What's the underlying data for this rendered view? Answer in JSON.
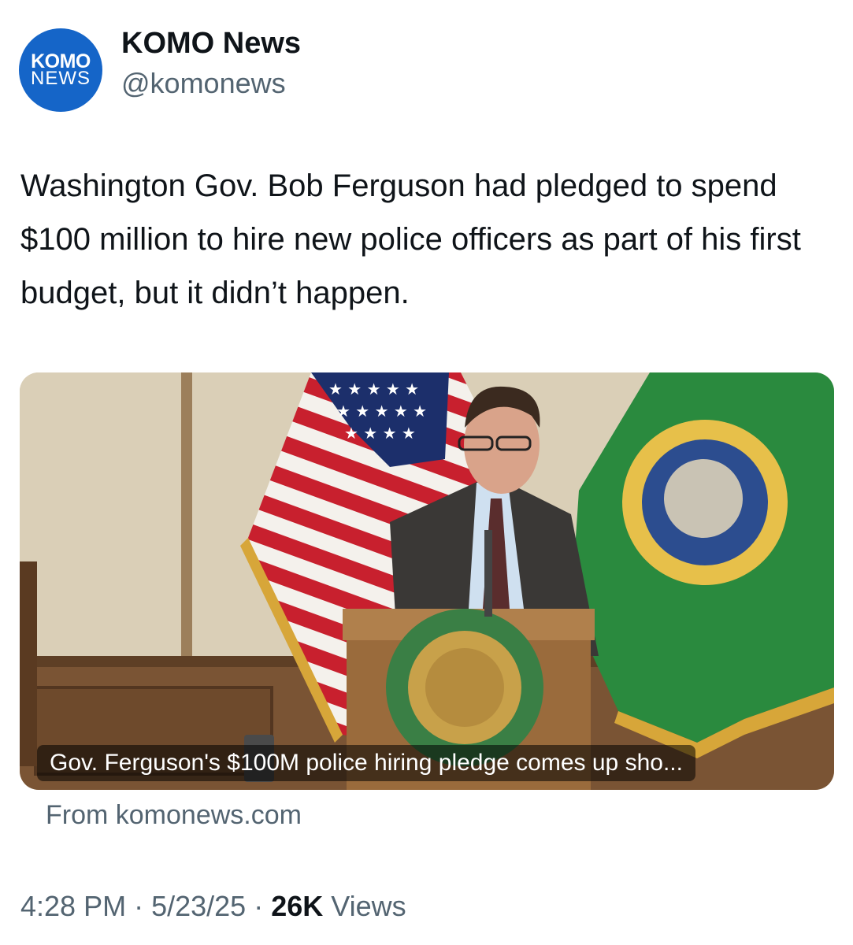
{
  "account": {
    "logo_line1": "KOMO",
    "logo_line2": "NEWS",
    "display_name": "KOMO News",
    "handle": "@komonews",
    "brand_color": "#1565c8"
  },
  "tweet": {
    "text": "Washington Gov. Bob Ferguson had pledged to spend $100 million to hire new police officers as part of his first budget, but it didn’t happen."
  },
  "card": {
    "image_description_icon": "photo-icon",
    "caption": "Gov. Ferguson's $100M police hiring pledge comes up sho...",
    "source": "From komonews.com"
  },
  "meta": {
    "time": "4:28 PM",
    "sep1": " · ",
    "date": "5/23/25",
    "sep2": " · ",
    "views_count": "26K",
    "views_label": " Views"
  }
}
